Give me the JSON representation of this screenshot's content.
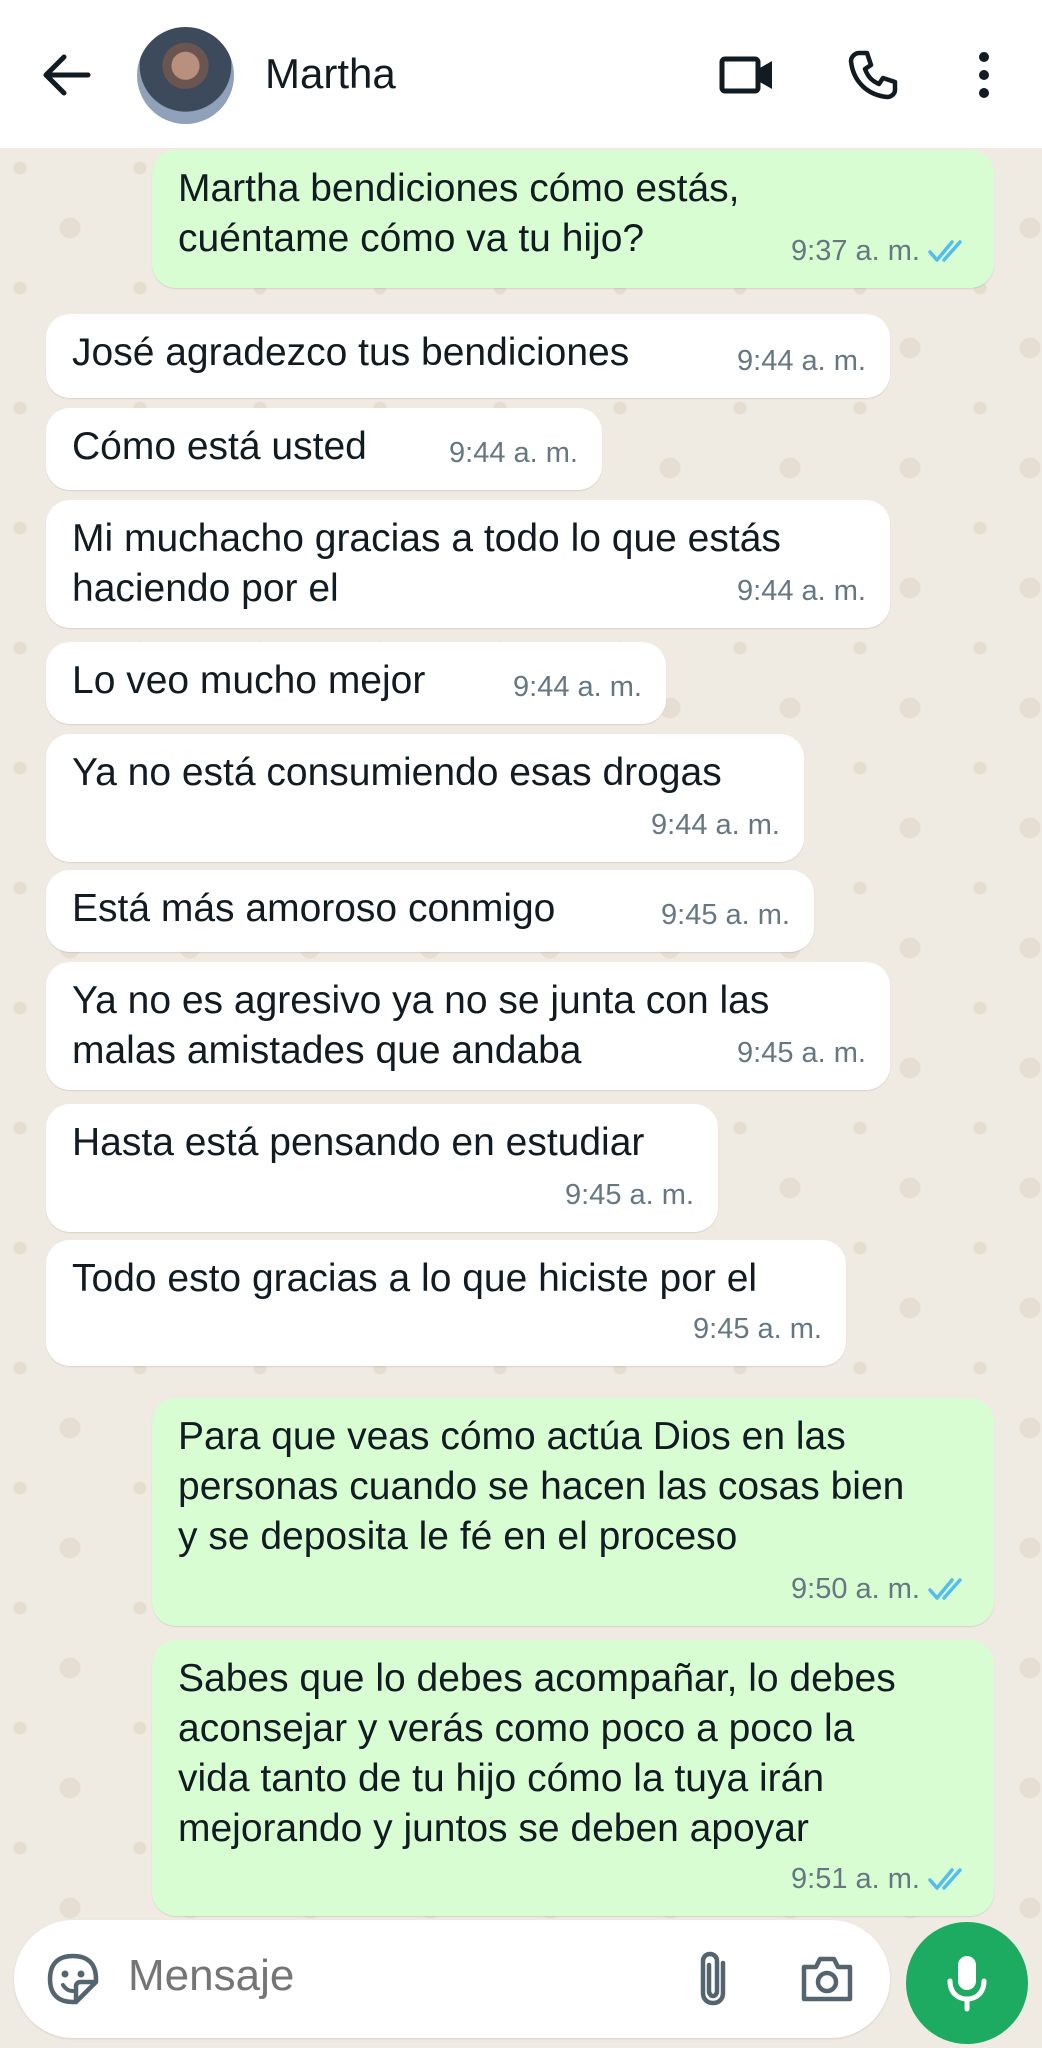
{
  "header": {
    "contact_name": "Martha",
    "icons": {
      "back": "arrow-left-icon",
      "video": "video-call-icon",
      "call": "phone-icon",
      "menu": "more-vert-icon"
    }
  },
  "colors": {
    "outgoing_bubble": "#d9fdd3",
    "incoming_bubble": "#ffffff",
    "read_ticks": "#53bdeb",
    "mic_button": "#1daa61",
    "chat_background": "#efeae2"
  },
  "messages": [
    {
      "direction": "out",
      "text": "Martha bendiciones cómo estás,\ncuéntame cómo va tu hijo?",
      "time": "9:37 a. m.",
      "status": "read"
    },
    {
      "direction": "in",
      "text": "José agradezco tus bendiciones",
      "time": "9:44 a. m."
    },
    {
      "direction": "in",
      "text": "Cómo está usted",
      "time": "9:44 a. m."
    },
    {
      "direction": "in",
      "text": "Mi muchacho gracias a todo lo que estás\nhaciendo por el",
      "time": "9:44 a. m."
    },
    {
      "direction": "in",
      "text": "Lo veo mucho mejor",
      "time": "9:44 a. m."
    },
    {
      "direction": "in",
      "text": "Ya no está consumiendo esas drogas",
      "time": "9:44 a. m."
    },
    {
      "direction": "in",
      "text": "Está más amoroso conmigo",
      "time": "9:45 a. m."
    },
    {
      "direction": "in",
      "text": "Ya no es agresivo ya no se junta con las\nmalas amistades que andaba",
      "time": "9:45 a. m."
    },
    {
      "direction": "in",
      "text": "Hasta está pensando en estudiar",
      "time": "9:45 a. m."
    },
    {
      "direction": "in",
      "text": "Todo esto gracias a lo que hiciste por el",
      "time": "9:45 a. m."
    },
    {
      "direction": "out",
      "text": "Para que veas cómo actúa Dios en las\npersonas cuando se hacen las cosas bien\ny se deposita le fé en el proceso",
      "time": "9:50 a. m.",
      "status": "read"
    },
    {
      "direction": "out",
      "text": "Sabes que lo debes acompañar, lo debes\naconsejar y verás como poco a poco la\nvida tanto de tu hijo cómo la tuya irán\nmejorando y juntos se deben apoyar",
      "time": "9:51 a. m.",
      "status": "read"
    }
  ],
  "composer": {
    "placeholder": "Mensaje",
    "icons": {
      "emoji": "sticker-emoji-icon",
      "attach": "paperclip-icon",
      "camera": "camera-icon",
      "mic": "microphone-icon"
    }
  }
}
